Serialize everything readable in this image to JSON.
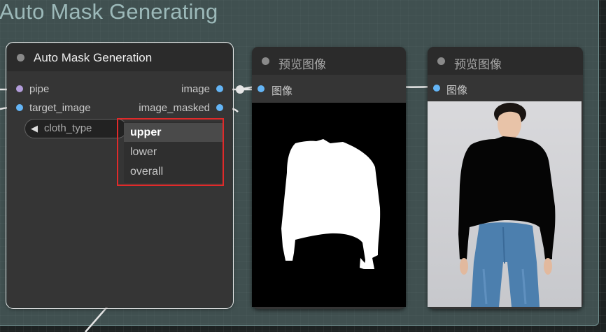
{
  "group": {
    "title": "Auto Mask Generating"
  },
  "auto_mask_node": {
    "title": "Auto Mask Generation",
    "inputs": [
      "pipe",
      "target_image"
    ],
    "outputs": [
      "image",
      "image_masked"
    ],
    "widget": {
      "label": "cloth_type"
    },
    "dropdown": {
      "options": [
        "upper",
        "lower",
        "overall"
      ],
      "highlighted": "upper"
    }
  },
  "preview1": {
    "title": "预览图像",
    "input": "图像"
  },
  "preview2": {
    "title": "预览图像",
    "input": "图像"
  },
  "colors": {
    "pipe_slot": "#b39ddb",
    "image_slot": "#64b5f6",
    "highlight_box": "#e02a2a",
    "wire": "#e6e6e6"
  }
}
